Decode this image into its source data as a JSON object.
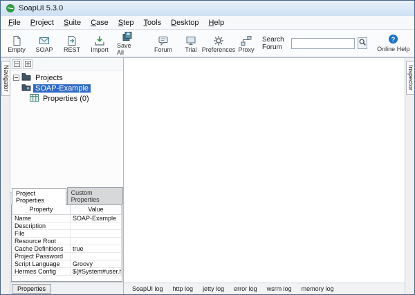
{
  "window": {
    "title": "SoapUI 5.3.0"
  },
  "menu": {
    "items": [
      "File",
      "Project",
      "Suite",
      "Case",
      "Step",
      "Tools",
      "Desktop",
      "Help"
    ]
  },
  "toolbar": {
    "buttons": [
      {
        "label": "Empty",
        "icon": "empty-project-icon"
      },
      {
        "label": "SOAP",
        "icon": "soap-project-icon"
      },
      {
        "label": "REST",
        "icon": "rest-project-icon"
      },
      {
        "label": "Import",
        "icon": "import-project-icon"
      },
      {
        "label": "Save All",
        "icon": "save-all-icon"
      },
      {
        "label": "Forum",
        "icon": "forum-icon"
      },
      {
        "label": "Trial",
        "icon": "trial-icon"
      },
      {
        "label": "Preferences",
        "icon": "preferences-gear-icon"
      },
      {
        "label": "Proxy",
        "icon": "proxy-icon"
      }
    ],
    "search_label": "Search Forum",
    "online_help_label": "Online Help"
  },
  "navigator": {
    "tab_label": "Navigator"
  },
  "inspector": {
    "tab_label": "Inspector"
  },
  "tree": {
    "root_label": "Projects",
    "project_label": "SOAP-Example",
    "child_label": "Properties (0)"
  },
  "properties_panel": {
    "tabs": [
      "Project Properties",
      "Custom Properties"
    ],
    "columns": [
      "Property",
      "Value"
    ],
    "rows": [
      {
        "property": "Name",
        "value": "SOAP-Example"
      },
      {
        "property": "Description",
        "value": ""
      },
      {
        "property": "File",
        "value": ""
      },
      {
        "property": "Resource Root",
        "value": ""
      },
      {
        "property": "Cache Definitions",
        "value": "true"
      },
      {
        "property": "Project Password",
        "value": ""
      },
      {
        "property": "Script Language",
        "value": "Groovy"
      },
      {
        "property": "Hermes Config",
        "value": "${#System#user.ho..."
      }
    ],
    "bottom_button": "Properties"
  },
  "logs": {
    "tabs": [
      "SoapUI log",
      "http log",
      "jetty log",
      "error log",
      "wsrm log",
      "memory log"
    ]
  },
  "colors": {
    "selection": "#2f6bc6",
    "help_icon": "#1a73c8",
    "import_arrow": "#2e9e3e"
  }
}
